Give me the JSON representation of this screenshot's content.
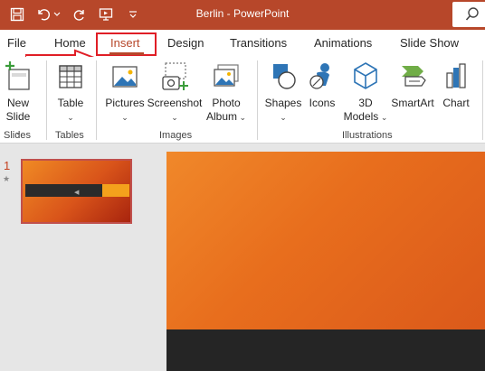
{
  "titlebar": {
    "title": "Berlin  -  PowerPoint"
  },
  "tabs": [
    {
      "label": "File"
    },
    {
      "label": "Home"
    },
    {
      "label": "Insert"
    },
    {
      "label": "Design"
    },
    {
      "label": "Transitions"
    },
    {
      "label": "Animations"
    },
    {
      "label": "Slide Show"
    }
  ],
  "ribbon": {
    "new_slide": {
      "line1": "New",
      "line2": "Slide"
    },
    "table": "Table",
    "pictures": "Pictures",
    "screenshot": "Screenshot",
    "photo_album": {
      "line1": "Photo",
      "line2": "Album"
    },
    "shapes": "Shapes",
    "icons": "Icons",
    "models_3d": {
      "line1": "3D",
      "line2": "Models"
    },
    "smartart": "SmartArt",
    "chart": "Chart",
    "groups": {
      "slides": "Slides",
      "tables": "Tables",
      "images": "Images",
      "illustrations": "Illustrations"
    }
  },
  "slide_panel": {
    "slide_number": "1",
    "star": "★"
  },
  "colors": {
    "accent": "#b7472a",
    "highlight": "#e01e26"
  }
}
